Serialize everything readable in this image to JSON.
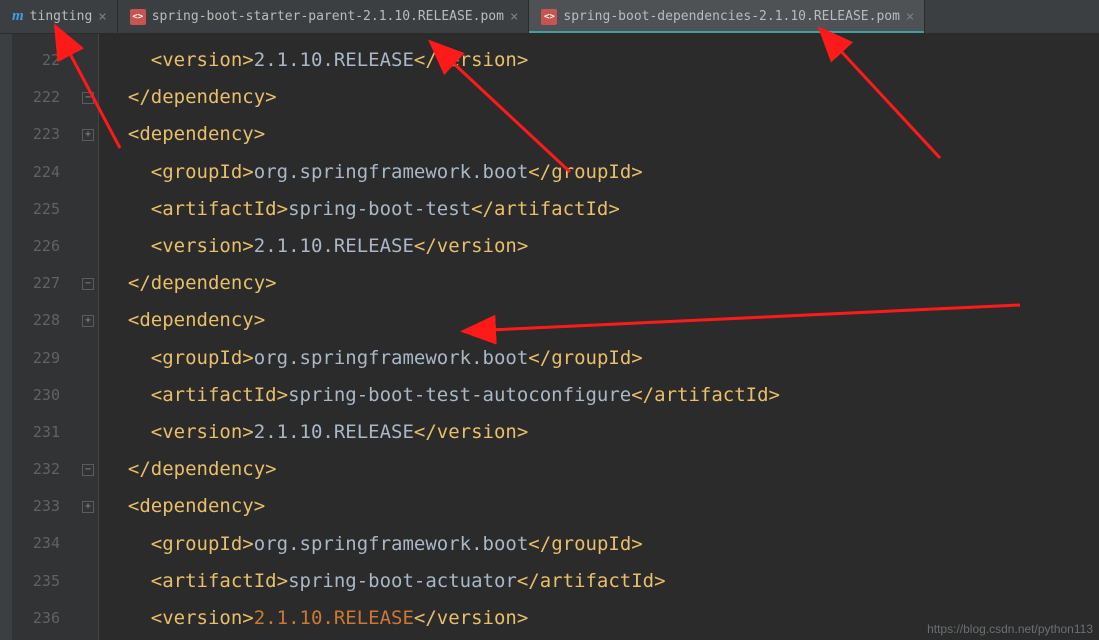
{
  "tabs": [
    {
      "icon": "m",
      "label": "tingting",
      "active": false
    },
    {
      "icon": "xml",
      "label": "spring-boot-starter-parent-2.1.10.RELEASE.pom",
      "active": false
    },
    {
      "icon": "xml",
      "label": "spring-boot-dependencies-2.1.10.RELEASE.pom",
      "active": true
    }
  ],
  "lineStart": 221,
  "lineNumbers": [
    "22",
    "222",
    "223",
    "224",
    "225",
    "226",
    "227",
    "228",
    "229",
    "230",
    "231",
    "232",
    "233",
    "234",
    "235",
    "236"
  ],
  "fold": {
    "1": "minus",
    "2": "plus",
    "6": "minus",
    "7": "plus",
    "11": "minus",
    "12": "plus"
  },
  "code": [
    {
      "indent": 6,
      "kind": "full",
      "tag": "version",
      "text": "2.1.10.RELEASE"
    },
    {
      "indent": 5,
      "kind": "close",
      "tag": "dependency"
    },
    {
      "indent": 5,
      "kind": "open",
      "tag": "dependency"
    },
    {
      "indent": 6,
      "kind": "full",
      "tag": "groupId",
      "text": "org.springframework.boot"
    },
    {
      "indent": 6,
      "kind": "full",
      "tag": "artifactId",
      "text": "spring-boot-test"
    },
    {
      "indent": 6,
      "kind": "full",
      "tag": "version",
      "text": "2.1.10.RELEASE"
    },
    {
      "indent": 5,
      "kind": "close",
      "tag": "dependency"
    },
    {
      "indent": 5,
      "kind": "open",
      "tag": "dependency"
    },
    {
      "indent": 6,
      "kind": "full",
      "tag": "groupId",
      "text": "org.springframework.boot"
    },
    {
      "indent": 6,
      "kind": "full",
      "tag": "artifactId",
      "text": "spring-boot-test-autoconfigure"
    },
    {
      "indent": 6,
      "kind": "full",
      "tag": "version",
      "text": "2.1.10.RELEASE"
    },
    {
      "indent": 5,
      "kind": "close",
      "tag": "dependency"
    },
    {
      "indent": 5,
      "kind": "open",
      "tag": "dependency"
    },
    {
      "indent": 6,
      "kind": "full",
      "tag": "groupId",
      "text": "org.springframework.boot"
    },
    {
      "indent": 6,
      "kind": "full",
      "tag": "artifactId",
      "text": "spring-boot-actuator"
    },
    {
      "indent": 6,
      "kind": "full",
      "tag": "version",
      "text": "2.1.10.RELEASE",
      "hot": true
    }
  ],
  "watermark": "https://blog.csdn.net/python113"
}
